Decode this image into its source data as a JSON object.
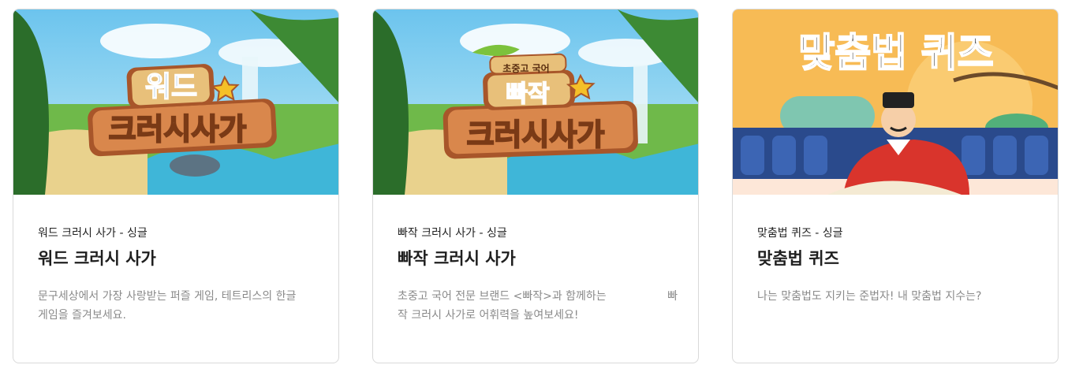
{
  "cards": [
    {
      "sub": "워드 크러시 사가 - 싱글",
      "title": "워드 크러시 사가",
      "desc": "문구세상에서 가장 사랑받는 퍼즐 게임, 테트리스의 한글 게임을 즐겨보세요.",
      "thumb": {
        "line1": "워드",
        "line2": "크러시사가"
      }
    },
    {
      "sub": "빠작 크러시 사가 - 싱글",
      "title": "빠작 크러시 사가",
      "desc": "초중고 국어 전문 브랜드 <빠작>과 함께하는",
      "desc_tail": "빠",
      "desc2": "작 크러시 사가로 어휘력을 높여보세요!",
      "thumb": {
        "tag": "초중고 국어",
        "line1": "빠작",
        "line2": "크러시사가"
      }
    },
    {
      "sub": "맞춤법 퀴즈 - 싱글",
      "title": "맞춤법 퀴즈",
      "desc": "나는 맞춤법도 지키는 준법자! 내 맞춤법 지수는?",
      "thumb": {
        "line1": "맞춤법 퀴즈"
      }
    }
  ],
  "colors": {
    "sky": "#8fd0ef",
    "wood": "#c8733a",
    "quiz_bg": "#f7bb55",
    "quiz_wall": "#2a4a8c"
  }
}
